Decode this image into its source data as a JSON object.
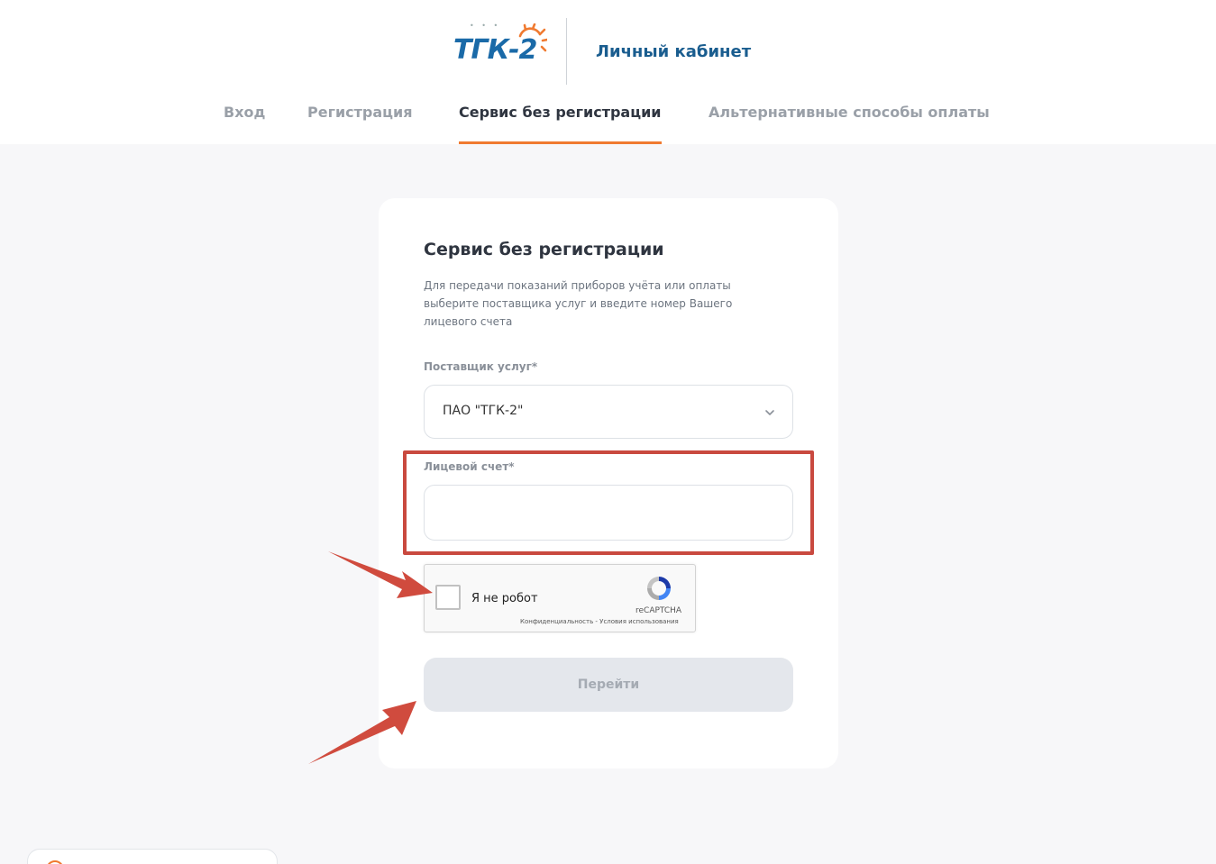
{
  "header": {
    "logo_text": "ТГК-2",
    "cabinet_title": "Личный кабинет"
  },
  "tabs": [
    {
      "label": "Вход",
      "active": false
    },
    {
      "label": "Регистрация",
      "active": false
    },
    {
      "label": "Сервис без регистрации",
      "active": true
    },
    {
      "label": "Альтернативные способы оплаты",
      "active": false
    }
  ],
  "form": {
    "title": "Сервис без регистрации",
    "description": "Для передачи показаний приборов учёта или оплаты выберите поставщика услуг и введите номер Вашего лицевого счета",
    "provider_label": "Поставщик услуг*",
    "provider_value": "ПАО \"ТГК-2\"",
    "account_label": "Лицевой счет*",
    "account_value": "",
    "submit_label": "Перейти"
  },
  "recaptcha": {
    "label": "Я не робот",
    "brand": "reCAPTCHA",
    "links": "Конфиденциальность - Условия использования"
  },
  "colors": {
    "accent": "#f07a30",
    "brand_blue": "#1a6aa8",
    "annotation_red": "#c9493f"
  }
}
